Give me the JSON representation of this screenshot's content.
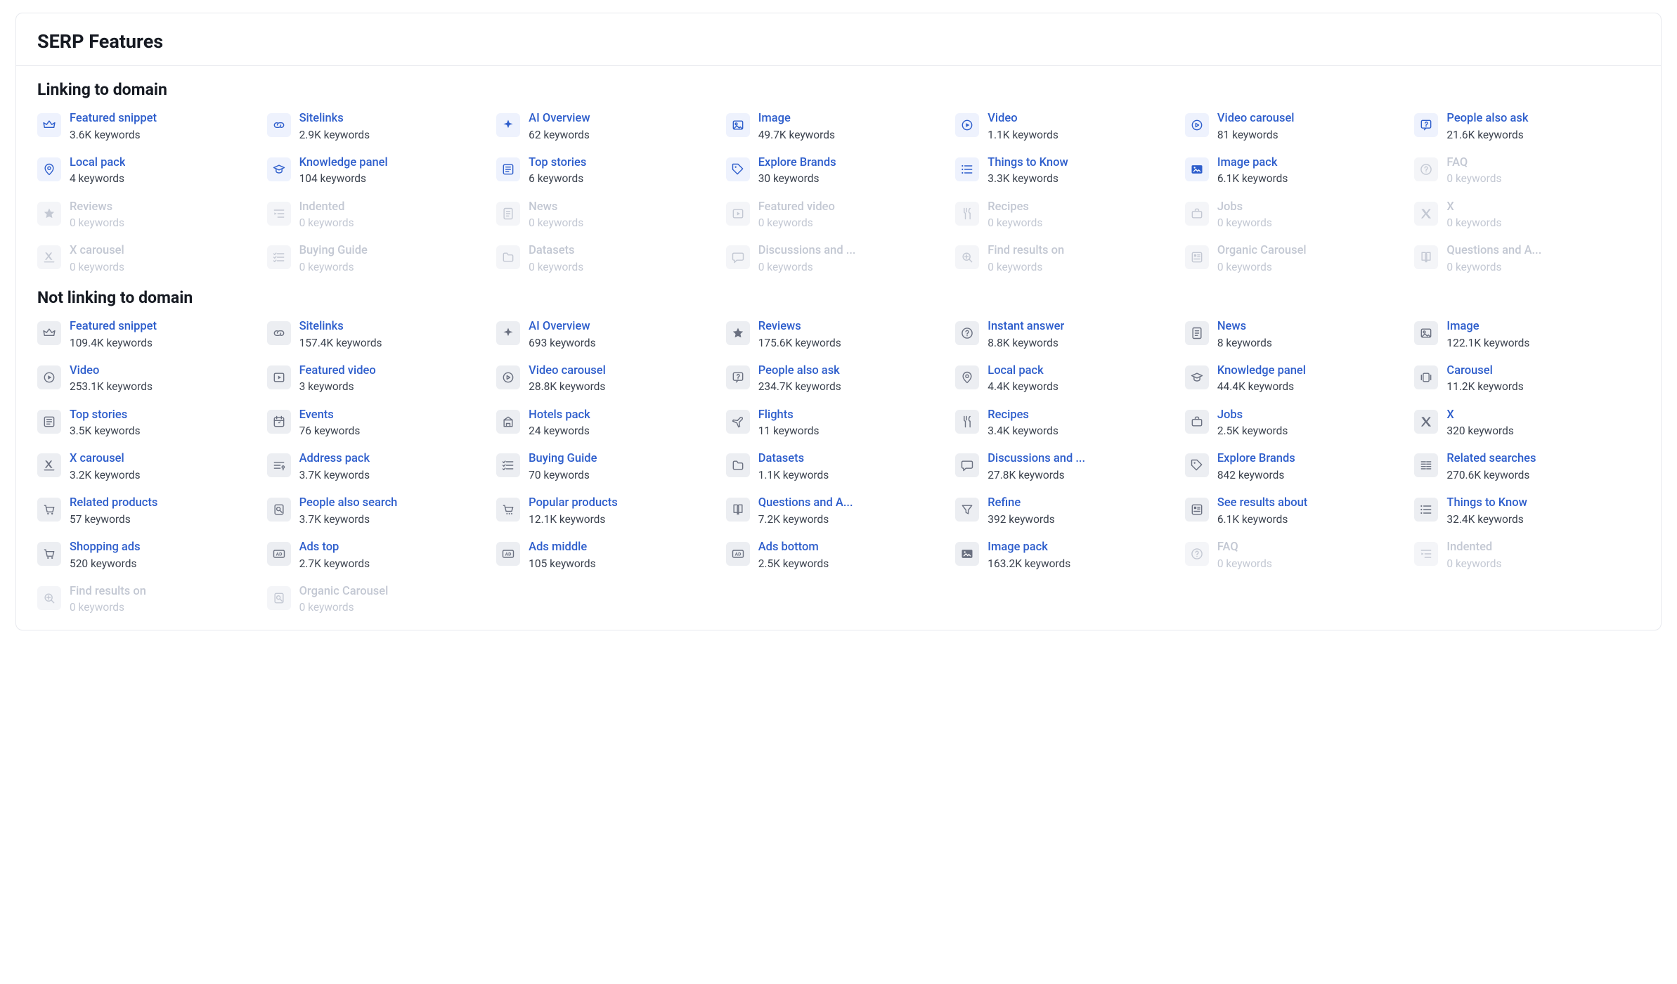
{
  "title": "SERP Features",
  "sections": [
    {
      "title": "Linking to domain",
      "items": [
        {
          "icon": "crown",
          "label": "Featured snippet",
          "sub": "3.6K keywords",
          "state": "active"
        },
        {
          "icon": "link",
          "label": "Sitelinks",
          "sub": "2.9K keywords",
          "state": "active"
        },
        {
          "icon": "sparkle",
          "label": "AI Overview",
          "sub": "62 keywords",
          "state": "active"
        },
        {
          "icon": "image",
          "label": "Image",
          "sub": "49.7K keywords",
          "state": "active"
        },
        {
          "icon": "play-circle",
          "label": "Video",
          "sub": "1.1K keywords",
          "state": "active"
        },
        {
          "icon": "play-ring",
          "label": "Video carousel",
          "sub": "81 keywords",
          "state": "active"
        },
        {
          "icon": "help-chat",
          "label": "People also ask",
          "sub": "21.6K keywords",
          "state": "active"
        },
        {
          "icon": "pin",
          "label": "Local pack",
          "sub": "4 keywords",
          "state": "active"
        },
        {
          "icon": "cap",
          "label": "Knowledge panel",
          "sub": "104 keywords",
          "state": "active"
        },
        {
          "icon": "news",
          "label": "Top stories",
          "sub": "6 keywords",
          "state": "active"
        },
        {
          "icon": "tag",
          "label": "Explore Brands",
          "sub": "30 keywords",
          "state": "active"
        },
        {
          "icon": "list",
          "label": "Things to Know",
          "sub": "3.3K keywords",
          "state": "active"
        },
        {
          "icon": "gallery",
          "label": "Image pack",
          "sub": "6.1K keywords",
          "state": "active"
        },
        {
          "icon": "help",
          "label": "FAQ",
          "sub": "0 keywords",
          "state": "disabled"
        },
        {
          "icon": "star",
          "label": "Reviews",
          "sub": "0 keywords",
          "state": "disabled"
        },
        {
          "icon": "indent",
          "label": "Indented",
          "sub": "0 keywords",
          "state": "disabled"
        },
        {
          "icon": "doc",
          "label": "News",
          "sub": "0 keywords",
          "state": "disabled"
        },
        {
          "icon": "play-box",
          "label": "Featured video",
          "sub": "0 keywords",
          "state": "disabled"
        },
        {
          "icon": "fork",
          "label": "Recipes",
          "sub": "0 keywords",
          "state": "disabled"
        },
        {
          "icon": "briefcase",
          "label": "Jobs",
          "sub": "0 keywords",
          "state": "disabled"
        },
        {
          "icon": "x",
          "label": "X",
          "sub": "0 keywords",
          "state": "disabled"
        },
        {
          "icon": "x-lines",
          "label": "X carousel",
          "sub": "0 keywords",
          "state": "disabled"
        },
        {
          "icon": "checklist",
          "label": "Buying Guide",
          "sub": "0 keywords",
          "state": "disabled"
        },
        {
          "icon": "folder",
          "label": "Datasets",
          "sub": "0 keywords",
          "state": "disabled"
        },
        {
          "icon": "chat",
          "label": "Discussions and ...",
          "sub": "0 keywords",
          "state": "disabled"
        },
        {
          "icon": "zoom",
          "label": "Find results on",
          "sub": "0 keywords",
          "state": "disabled"
        },
        {
          "icon": "card-list",
          "label": "Organic Carousel",
          "sub": "0 keywords",
          "state": "disabled"
        },
        {
          "icon": "book",
          "label": "Questions and A...",
          "sub": "0 keywords",
          "state": "disabled"
        }
      ]
    },
    {
      "title": "Not linking to domain",
      "items": [
        {
          "icon": "crown",
          "label": "Featured snippet",
          "sub": "109.4K keywords",
          "state": "grey"
        },
        {
          "icon": "link",
          "label": "Sitelinks",
          "sub": "157.4K keywords",
          "state": "grey"
        },
        {
          "icon": "sparkle",
          "label": "AI Overview",
          "sub": "693 keywords",
          "state": "grey"
        },
        {
          "icon": "star",
          "label": "Reviews",
          "sub": "175.6K keywords",
          "state": "grey"
        },
        {
          "icon": "help",
          "label": "Instant answer",
          "sub": "8.8K keywords",
          "state": "grey"
        },
        {
          "icon": "doc",
          "label": "News",
          "sub": "8 keywords",
          "state": "grey"
        },
        {
          "icon": "image",
          "label": "Image",
          "sub": "122.1K keywords",
          "state": "grey"
        },
        {
          "icon": "play-circle",
          "label": "Video",
          "sub": "253.1K keywords",
          "state": "grey"
        },
        {
          "icon": "play-box",
          "label": "Featured video",
          "sub": "3 keywords",
          "state": "grey"
        },
        {
          "icon": "play-ring",
          "label": "Video carousel",
          "sub": "28.8K keywords",
          "state": "grey"
        },
        {
          "icon": "help-chat",
          "label": "People also ask",
          "sub": "234.7K keywords",
          "state": "grey"
        },
        {
          "icon": "pin",
          "label": "Local pack",
          "sub": "4.4K keywords",
          "state": "grey"
        },
        {
          "icon": "cap",
          "label": "Knowledge panel",
          "sub": "44.4K keywords",
          "state": "grey"
        },
        {
          "icon": "carousel",
          "label": "Carousel",
          "sub": "11.2K keywords",
          "state": "grey"
        },
        {
          "icon": "news",
          "label": "Top stories",
          "sub": "3.5K keywords",
          "state": "grey"
        },
        {
          "icon": "calendar",
          "label": "Events",
          "sub": "76 keywords",
          "state": "grey"
        },
        {
          "icon": "hotel",
          "label": "Hotels pack",
          "sub": "24 keywords",
          "state": "grey"
        },
        {
          "icon": "plane",
          "label": "Flights",
          "sub": "11 keywords",
          "state": "grey"
        },
        {
          "icon": "fork",
          "label": "Recipes",
          "sub": "3.4K keywords",
          "state": "grey"
        },
        {
          "icon": "briefcase",
          "label": "Jobs",
          "sub": "2.5K keywords",
          "state": "grey"
        },
        {
          "icon": "x",
          "label": "X",
          "sub": "320 keywords",
          "state": "grey"
        },
        {
          "icon": "x-lines",
          "label": "X carousel",
          "sub": "3.2K keywords",
          "state": "grey"
        },
        {
          "icon": "address",
          "label": "Address pack",
          "sub": "3.7K keywords",
          "state": "grey"
        },
        {
          "icon": "checklist",
          "label": "Buying Guide",
          "sub": "70 keywords",
          "state": "grey"
        },
        {
          "icon": "folder",
          "label": "Datasets",
          "sub": "1.1K keywords",
          "state": "grey"
        },
        {
          "icon": "chat",
          "label": "Discussions and ...",
          "sub": "27.8K keywords",
          "state": "grey"
        },
        {
          "icon": "tag",
          "label": "Explore Brands",
          "sub": "842 keywords",
          "state": "grey"
        },
        {
          "icon": "rows",
          "label": "Related searches",
          "sub": "270.6K keywords",
          "state": "grey"
        },
        {
          "icon": "cart",
          "label": "Related products",
          "sub": "57 keywords",
          "state": "grey"
        },
        {
          "icon": "search-doc",
          "label": "People also search",
          "sub": "3.7K keywords",
          "state": "grey"
        },
        {
          "icon": "cart-dots",
          "label": "Popular products",
          "sub": "12.1K keywords",
          "state": "grey"
        },
        {
          "icon": "book",
          "label": "Questions and A...",
          "sub": "7.2K keywords",
          "state": "grey"
        },
        {
          "icon": "funnel",
          "label": "Refine",
          "sub": "392 keywords",
          "state": "grey"
        },
        {
          "icon": "card-list",
          "label": "See results about",
          "sub": "6.1K keywords",
          "state": "grey"
        },
        {
          "icon": "list",
          "label": "Things to Know",
          "sub": "32.4K keywords",
          "state": "grey"
        },
        {
          "icon": "cart",
          "label": "Shopping ads",
          "sub": "520 keywords",
          "state": "grey"
        },
        {
          "icon": "ad",
          "label": "Ads top",
          "sub": "2.7K keywords",
          "state": "grey"
        },
        {
          "icon": "ad",
          "label": "Ads middle",
          "sub": "105 keywords",
          "state": "grey"
        },
        {
          "icon": "ad",
          "label": "Ads bottom",
          "sub": "2.5K keywords",
          "state": "grey"
        },
        {
          "icon": "gallery",
          "label": "Image pack",
          "sub": "163.2K keywords",
          "state": "grey"
        },
        {
          "icon": "help",
          "label": "FAQ",
          "sub": "0 keywords",
          "state": "disabled"
        },
        {
          "icon": "indent",
          "label": "Indented",
          "sub": "0 keywords",
          "state": "disabled"
        },
        {
          "icon": "zoom",
          "label": "Find results on",
          "sub": "0 keywords",
          "state": "disabled"
        },
        {
          "icon": "search-doc",
          "label": "Organic Carousel",
          "sub": "0 keywords",
          "state": "disabled"
        }
      ]
    }
  ]
}
